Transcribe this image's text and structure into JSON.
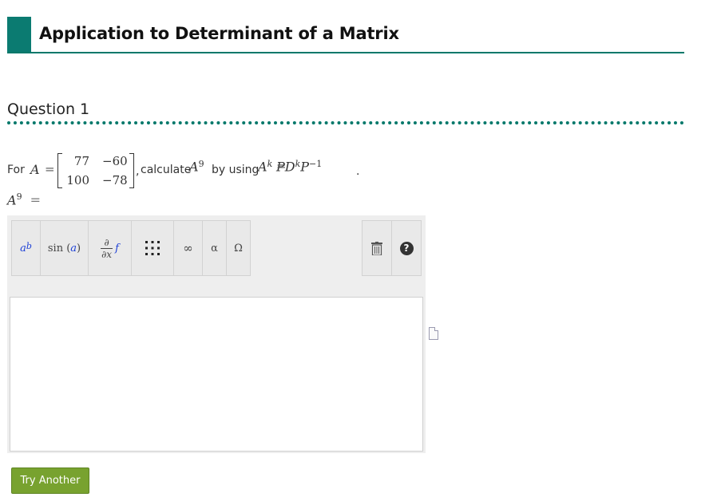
{
  "header": {
    "title": "Application to Determinant of a Matrix"
  },
  "question": {
    "title": "Question 1"
  },
  "problem": {
    "for": "For",
    "var": "A",
    "eq": "=",
    "matrix": [
      [
        "77",
        "−60"
      ],
      [
        "100",
        "−78"
      ]
    ],
    "comma": ",",
    "calculate": "calculate",
    "power": "9",
    "by_using": "by using",
    "k": "k",
    "rhs_P": "P",
    "rhs_D": "D",
    "rhs_neg1": "−1",
    "period": "."
  },
  "answer": {
    "var": "A",
    "power": "9",
    "eq": "="
  },
  "toolbar": {
    "superscript_a": "a",
    "superscript_b": "b",
    "sin_label": "sin",
    "sin_arg": "a",
    "partial_num": "∂",
    "partial_den": "∂x",
    "partial_f": "f",
    "matrix_icon": "matrix-grid-icon",
    "infinity": "∞",
    "alpha": "α",
    "omega": "Ω",
    "trash_icon": "trash-icon",
    "help_icon": "help-icon",
    "help_glyph": "?"
  },
  "buttons": {
    "try_another": "Try Another"
  },
  "colors": {
    "brand": "#0b7b71",
    "button": "#78a22f",
    "math_blue": "#1c3fd6"
  }
}
